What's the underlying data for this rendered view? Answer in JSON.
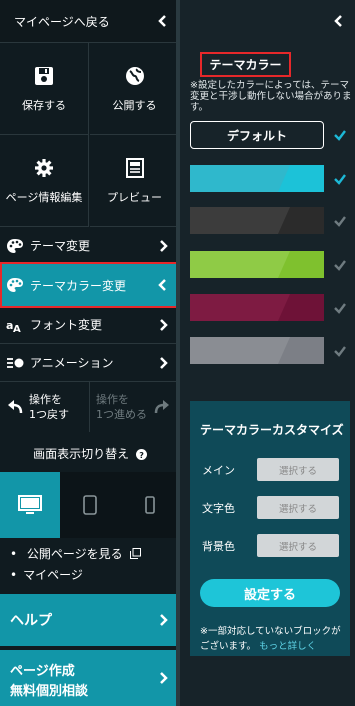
{
  "sidebar": {
    "back_label": "マイページへ戻る",
    "grid": [
      {
        "label": "保存する",
        "icon": "save-icon"
      },
      {
        "label": "公開する",
        "icon": "globe-icon"
      },
      {
        "label": "ページ情報編集",
        "icon": "gear-icon"
      },
      {
        "label": "プレビュー",
        "icon": "preview-icon"
      }
    ],
    "menu": [
      {
        "label": "テーマ変更",
        "icon": "palette-icon"
      },
      {
        "label": "テーマカラー変更",
        "icon": "palette-icon",
        "active": true
      },
      {
        "label": "フォント変更",
        "icon": "font-icon"
      },
      {
        "label": "アニメーション",
        "icon": "animation-icon"
      }
    ],
    "undo_label_1": "操作を",
    "undo_label_2": "1つ戻す",
    "redo_label_1": "操作を",
    "redo_label_2": "1つ進める",
    "screen_switch_title": "画面表示切り替え",
    "links": {
      "public_page": "公開ページを見る",
      "mypage": "マイページ"
    },
    "help_label": "ヘルプ",
    "consult_label_1": "ページ作成",
    "consult_label_2": "無料個別相談"
  },
  "panel": {
    "title": "テーマカラー",
    "note": "※設定したカラーによっては、テーマ変更と干渉し動作しない場合があります。",
    "default_label": "デフォルト",
    "swatches": [
      {
        "main": "#1cc2d8",
        "accent": "#2fb8cc",
        "selected": true
      },
      {
        "main": "#2b2b2b",
        "accent": "#3c3c3c",
        "selected": false
      },
      {
        "main": "#7fc12e",
        "accent": "#8fcb46",
        "selected": false
      },
      {
        "main": "#6e1237",
        "accent": "#7e1b42",
        "selected": false
      },
      {
        "main": "#7c7f86",
        "accent": "#8a8d93",
        "selected": false
      }
    ],
    "customize": {
      "title": "テーマカラーカスタマイズ",
      "fields": [
        {
          "label": "メイン",
          "button": "選択する"
        },
        {
          "label": "文字色",
          "button": "選択する"
        },
        {
          "label": "背景色",
          "button": "選択する"
        }
      ],
      "apply_label": "設定する",
      "footnote": "※一部対応していないブロックがございます。",
      "more_link": "もっと詳しく"
    }
  },
  "colors": {
    "accent": "#1296a8",
    "highlight": "#e6282a",
    "check": "#1cb8d6"
  }
}
